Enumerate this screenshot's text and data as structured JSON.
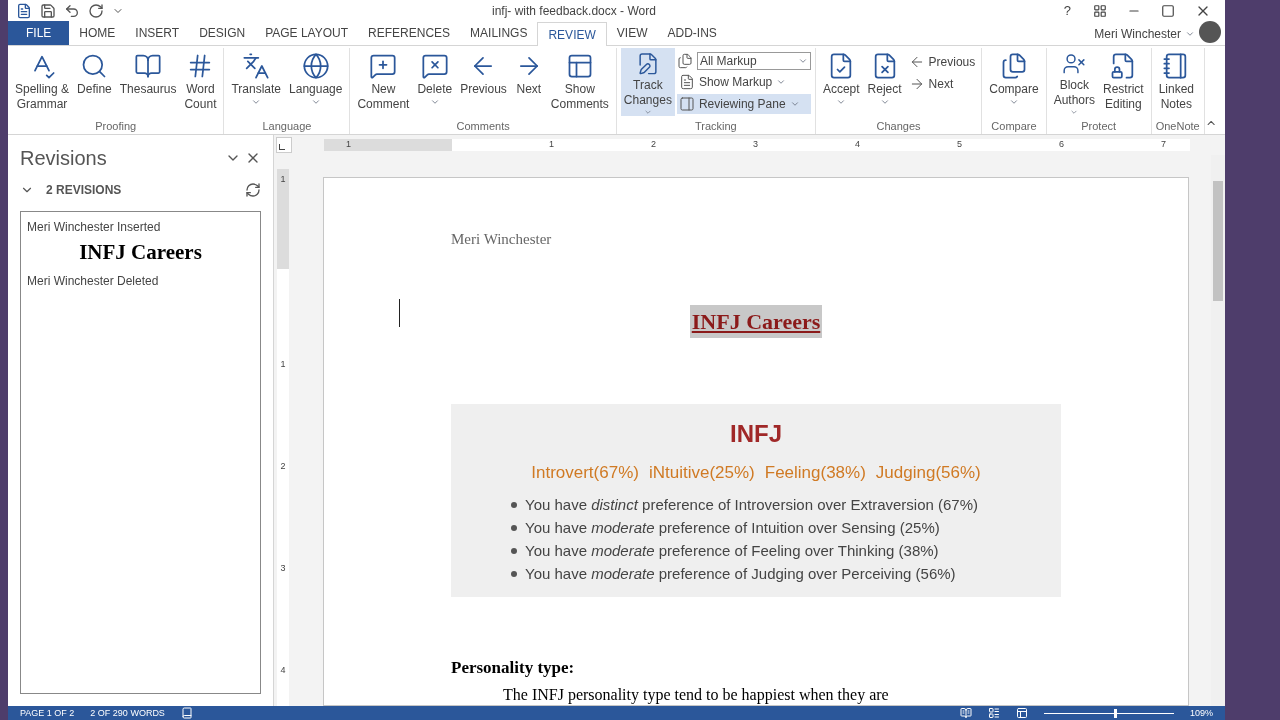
{
  "window": {
    "title": "infj- with feedback.docx - Word",
    "help": "?"
  },
  "tabs": [
    {
      "label": "FILE",
      "selected": false,
      "kind": "file"
    },
    {
      "label": "HOME",
      "selected": false,
      "kind": "tab"
    },
    {
      "label": "INSERT",
      "selected": false,
      "kind": "tab"
    },
    {
      "label": "DESIGN",
      "selected": false,
      "kind": "tab"
    },
    {
      "label": "PAGE LAYOUT",
      "selected": false,
      "kind": "tab"
    },
    {
      "label": "REFERENCES",
      "selected": false,
      "kind": "tab"
    },
    {
      "label": "MAILINGS",
      "selected": false,
      "kind": "tab"
    },
    {
      "label": "REVIEW",
      "selected": true,
      "kind": "tab"
    },
    {
      "label": "VIEW",
      "selected": false,
      "kind": "tab"
    },
    {
      "label": "ADD-INS",
      "selected": false,
      "kind": "tab"
    }
  ],
  "user": "Meri Winchester",
  "ribbon": [
    {
      "label": "Proofing",
      "items": [
        {
          "kind": "large",
          "label": "Spelling &\nGrammar",
          "menu": false,
          "on": false
        },
        {
          "kind": "large",
          "label": "Define",
          "menu": false,
          "on": false
        },
        {
          "kind": "large",
          "label": "Thesaurus",
          "menu": false,
          "on": false
        },
        {
          "kind": "large",
          "label": "Word\nCount",
          "menu": false,
          "on": false
        }
      ]
    },
    {
      "label": "Language",
      "items": [
        {
          "kind": "large",
          "label": "Translate",
          "menu": true,
          "on": false
        },
        {
          "kind": "large",
          "label": "Language",
          "menu": true,
          "on": false
        }
      ]
    },
    {
      "label": "Comments",
      "items": [
        {
          "kind": "large",
          "label": "New\nComment",
          "menu": false,
          "on": false
        },
        {
          "kind": "large",
          "label": "Delete",
          "menu": true,
          "on": false
        },
        {
          "kind": "large",
          "label": "Previous",
          "menu": false,
          "on": false
        },
        {
          "kind": "large",
          "label": "Next",
          "menu": false,
          "on": false
        },
        {
          "kind": "large",
          "label": "Show\nComments",
          "menu": false,
          "on": false
        }
      ]
    },
    {
      "label": "Tracking",
      "items": [
        {
          "kind": "large",
          "label": "Track\nChanges",
          "menu": true,
          "on": true
        },
        {
          "kind": "select",
          "label": "All Markup",
          "menu": true,
          "on": false
        },
        {
          "kind": "small",
          "label": "Show Markup",
          "menu": true,
          "on": false
        },
        {
          "kind": "small",
          "label": "Reviewing Pane",
          "menu": true,
          "on": true
        }
      ]
    },
    {
      "label": "Changes",
      "items": [
        {
          "kind": "large",
          "label": "Accept",
          "menu": true,
          "on": false
        },
        {
          "kind": "large",
          "label": "Reject",
          "menu": true,
          "on": false
        },
        {
          "kind": "small",
          "label": "Previous",
          "menu": false,
          "on": false
        },
        {
          "kind": "small",
          "label": "Next",
          "menu": false,
          "on": false
        }
      ]
    },
    {
      "label": "Compare",
      "items": [
        {
          "kind": "large",
          "label": "Compare",
          "menu": true,
          "on": false
        }
      ]
    },
    {
      "label": "Protect",
      "items": [
        {
          "kind": "large",
          "label": "Block\nAuthors",
          "menu": true,
          "on": false
        },
        {
          "kind": "large",
          "label": "Restrict\nEditing",
          "menu": false,
          "on": false
        }
      ]
    },
    {
      "label": "OneNote",
      "items": [
        {
          "kind": "large",
          "label": "Linked\nNotes",
          "menu": false,
          "on": false
        }
      ]
    }
  ],
  "revisions": {
    "title": "Revisions",
    "count": "2 REVISIONS",
    "entries": [
      {
        "header": "Meri Winchester Inserted",
        "content": "INFJ Careers"
      },
      {
        "header": "Meri Winchester Deleted"
      }
    ]
  },
  "rulers": {
    "horizontal": [
      "1",
      "1",
      "2",
      "3",
      "4",
      "5",
      "6",
      "7"
    ],
    "vertical": [
      "1",
      "1",
      "2",
      "3",
      "4"
    ]
  },
  "document": {
    "header": "Meri Winchester",
    "title": "INFJ Careers",
    "box": {
      "heading": "INFJ",
      "traits": [
        "Introvert(67%)",
        "iNtuitive(25%)",
        "Feeling(38%)",
        "Judging(56%)"
      ],
      "bullets": [
        "You have *distinct* preference of Introversion over Extraversion (67%)",
        "You have *moderate* preference of Intuition over Sensing (25%)",
        "You have *moderate* preference of Feeling over Thinking (38%)",
        "You have *moderate* preference of Judging over Perceiving (56%)"
      ]
    },
    "section": "Personality type:",
    "paragraph": "The INFJ personality type tend to be happiest when they are"
  },
  "status": {
    "page": "PAGE 1 OF 2",
    "words": "2 OF 290 WORDS",
    "zoom": "109%",
    "zoom_slider": {
      "level": 0.55
    }
  }
}
